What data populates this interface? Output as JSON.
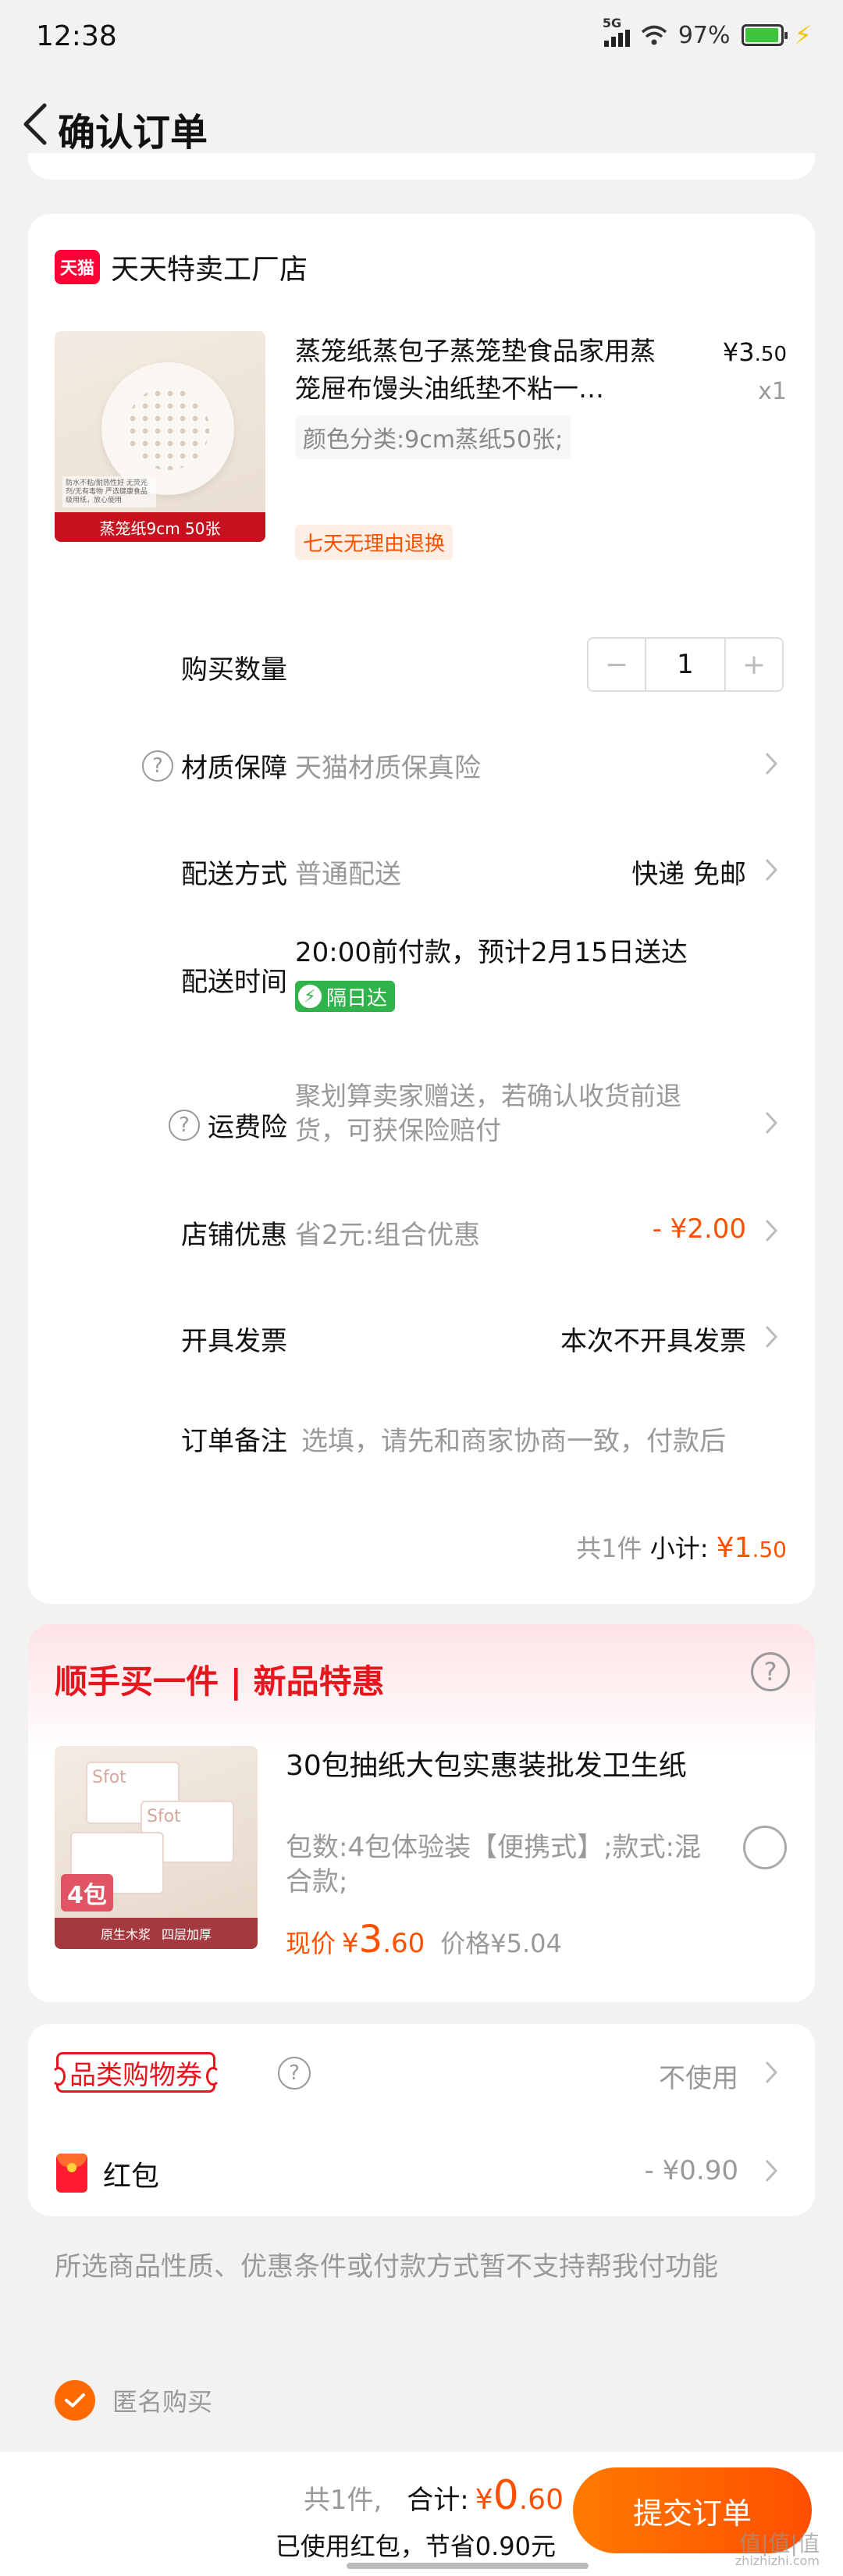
{
  "status_bar": {
    "time": "12:38",
    "network": "5G",
    "battery": "97%",
    "battery_level": 0.97
  },
  "nav": {
    "title": "确认订单"
  },
  "shop": {
    "logo_text": "天猫",
    "name": "天天特卖工厂店"
  },
  "product": {
    "title": "蒸笼纸蒸包子蒸笼垫食品家用蒸笼屉布馒头油纸垫不粘一…",
    "price_symbol": "¥",
    "price_int": "3",
    "price_dec": ".50",
    "qty": "x1",
    "spec": "颜色分类:9cm蒸纸50张;",
    "tag": "七天无理由退换",
    "image_banner": "蒸笼纸9cm 50张",
    "image_features": "防水不粘/耐热性好 无荧光剂/无有毒物 严选健康食品级用纸，放心使用"
  },
  "rows": {
    "quantity": {
      "label": "购买数量",
      "minus": "−",
      "value": "1",
      "plus": "+"
    },
    "material": {
      "label": "材质保障",
      "value": "天猫材质保真险"
    },
    "shipping": {
      "label": "配送方式",
      "value": "普通配送",
      "right": "快递 免邮"
    },
    "delivery_time": {
      "label": "配送时间",
      "value": "20:00前付款，预计2月15日送达",
      "badge": "隔日达",
      "badge_icon": "⚡"
    },
    "freight_insurance": {
      "label": "运费险",
      "value": "聚划算卖家赠送，若确认收货前退货，可获保险赔付"
    },
    "shop_discount": {
      "label": "店铺优惠",
      "value": "省2元:组合优惠",
      "right": "- ¥2.00"
    },
    "invoice": {
      "label": "开具发票",
      "right": "本次不开具发票"
    },
    "remark": {
      "label": "订单备注",
      "placeholder": "选填，请先和商家协商一致，付款后"
    }
  },
  "subtotal": {
    "count": "共1件",
    "label": "小计:",
    "symbol": "¥",
    "int": "1",
    "dec": ".50"
  },
  "addon": {
    "title": "顺手买一件 | 新品特惠",
    "name": "30包抽纸大包实惠装批发卫生纸",
    "spec": "包数:4包体验装【便携式】;款式:混合款;",
    "now_label": "现价",
    "price_symbol": "¥",
    "price_int": "3",
    "price_dec": ".60",
    "orig_price": "价格¥5.04",
    "image_brand": "Sfot",
    "image_count": "4包",
    "image_foot_1": "原生木浆",
    "image_foot_2": "四层加厚"
  },
  "coupon": {
    "label": "品类购物券",
    "value": "不使用"
  },
  "redpack": {
    "label": "红包",
    "value": "- ¥0.90"
  },
  "notice": "所选商品性质、优惠条件或付款方式暂不支持帮我付功能",
  "anonymous": {
    "label": "匿名购买",
    "checked": true
  },
  "bottom": {
    "count": "共1件,",
    "total_label": "合计:",
    "symbol": "¥",
    "int": "0",
    "dec": ".60",
    "saved": "已使用红包，节省0.90元",
    "submit": "提交订单"
  },
  "watermark": {
    "text": "值|值|值",
    "sub": "zhizhizhi.com"
  },
  "colors": {
    "accent": "#ff5000",
    "red": "#e6151e",
    "green": "#2fb34a",
    "tmall": "#ff0036"
  }
}
